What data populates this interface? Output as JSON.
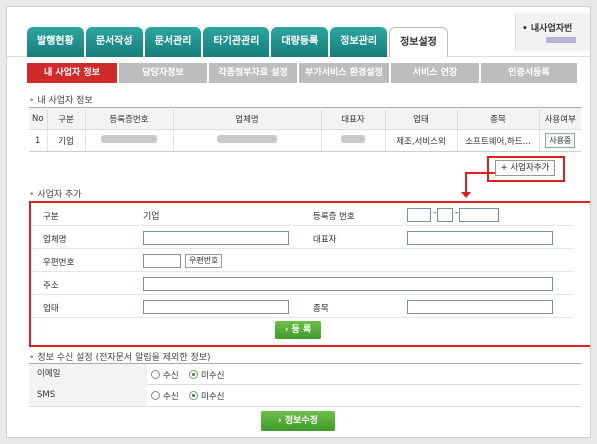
{
  "top_tabs": [
    "발행현황",
    "문서작성",
    "문서관리",
    "타기관관리",
    "대량등록",
    "정보관리",
    "정보설정"
  ],
  "top_right_label": "• 내사업자번",
  "sub_tabs": [
    "내 사업자 정보",
    "담당자정보",
    "각종첨부자료 설정",
    "부가서비스 환경설정",
    "서비스 연장",
    "인증서등록"
  ],
  "business_section_title": "내 사업자 정보",
  "table": {
    "headers": [
      "No",
      "구분",
      "등록증번호",
      "업체명",
      "대표자",
      "업태",
      "종목",
      "사용여부"
    ],
    "row": {
      "no": "1",
      "type": "기업",
      "business_type": "제조,서비스외",
      "item": "소프트웨어,하드...",
      "usage_button": "사용중"
    }
  },
  "add_business_button": "+ 사업자추가",
  "add_section_title": "사업자 추가",
  "form": {
    "type_label": "구분",
    "type_value": "기업",
    "reg_no_label": "등록증 번호",
    "name_label": "업체명",
    "rep_label": "대표자",
    "zip_label": "우편번호",
    "zip_button": "우편번호",
    "addr_label": "주소",
    "biz_label": "업태",
    "item_label": "종목",
    "register_button": "› 등 록"
  },
  "notify_section_title": "정보 수신 설정 (전자문서 알림을 제외한 정보)",
  "notify": {
    "email_label": "이메일",
    "sms_label": "SMS",
    "receive": "수신",
    "not_receive": "미수신"
  },
  "save_button": "› 정보수정"
}
